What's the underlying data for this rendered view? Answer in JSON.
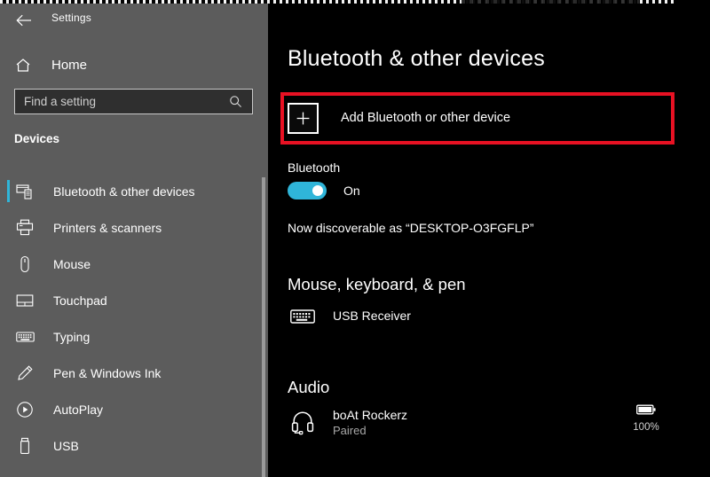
{
  "window": {
    "back_icon": "back-arrow-icon",
    "title": "Settings"
  },
  "sidebar": {
    "home": {
      "label": "Home",
      "icon": "home-icon"
    },
    "search": {
      "placeholder": "Find a setting",
      "value": "",
      "icon": "search-icon"
    },
    "section_title": "Devices",
    "items": [
      {
        "label": "Bluetooth & other devices",
        "icon": "bluetooth-devices-icon",
        "selected": true
      },
      {
        "label": "Printers & scanners",
        "icon": "printer-icon",
        "selected": false
      },
      {
        "label": "Mouse",
        "icon": "mouse-icon",
        "selected": false
      },
      {
        "label": "Touchpad",
        "icon": "touchpad-icon",
        "selected": false
      },
      {
        "label": "Typing",
        "icon": "keyboard-icon",
        "selected": false
      },
      {
        "label": "Pen & Windows Ink",
        "icon": "pen-icon",
        "selected": false
      },
      {
        "label": "AutoPlay",
        "icon": "autoplay-icon",
        "selected": false
      },
      {
        "label": "USB",
        "icon": "usb-icon",
        "selected": false
      }
    ]
  },
  "main": {
    "page_title": "Bluetooth & other devices",
    "add_device": {
      "label": "Add Bluetooth or other device",
      "icon": "plus-icon",
      "highlighted": true,
      "highlight_color": "#e81123"
    },
    "bluetooth": {
      "heading": "Bluetooth",
      "toggle_state": "On",
      "toggle_color": "#2fb5d9",
      "discoverable_text": "Now discoverable as “DESKTOP-O3FGFLP”"
    },
    "groups": [
      {
        "heading": "Mouse, keyboard, & pen",
        "devices": [
          {
            "name": "USB Receiver",
            "status": "",
            "icon": "keyboard-icon",
            "battery": ""
          }
        ]
      },
      {
        "heading": "Audio",
        "devices": [
          {
            "name": "boAt Rockerz",
            "status": "Paired",
            "icon": "headset-icon",
            "battery": "100%"
          }
        ]
      }
    ]
  }
}
